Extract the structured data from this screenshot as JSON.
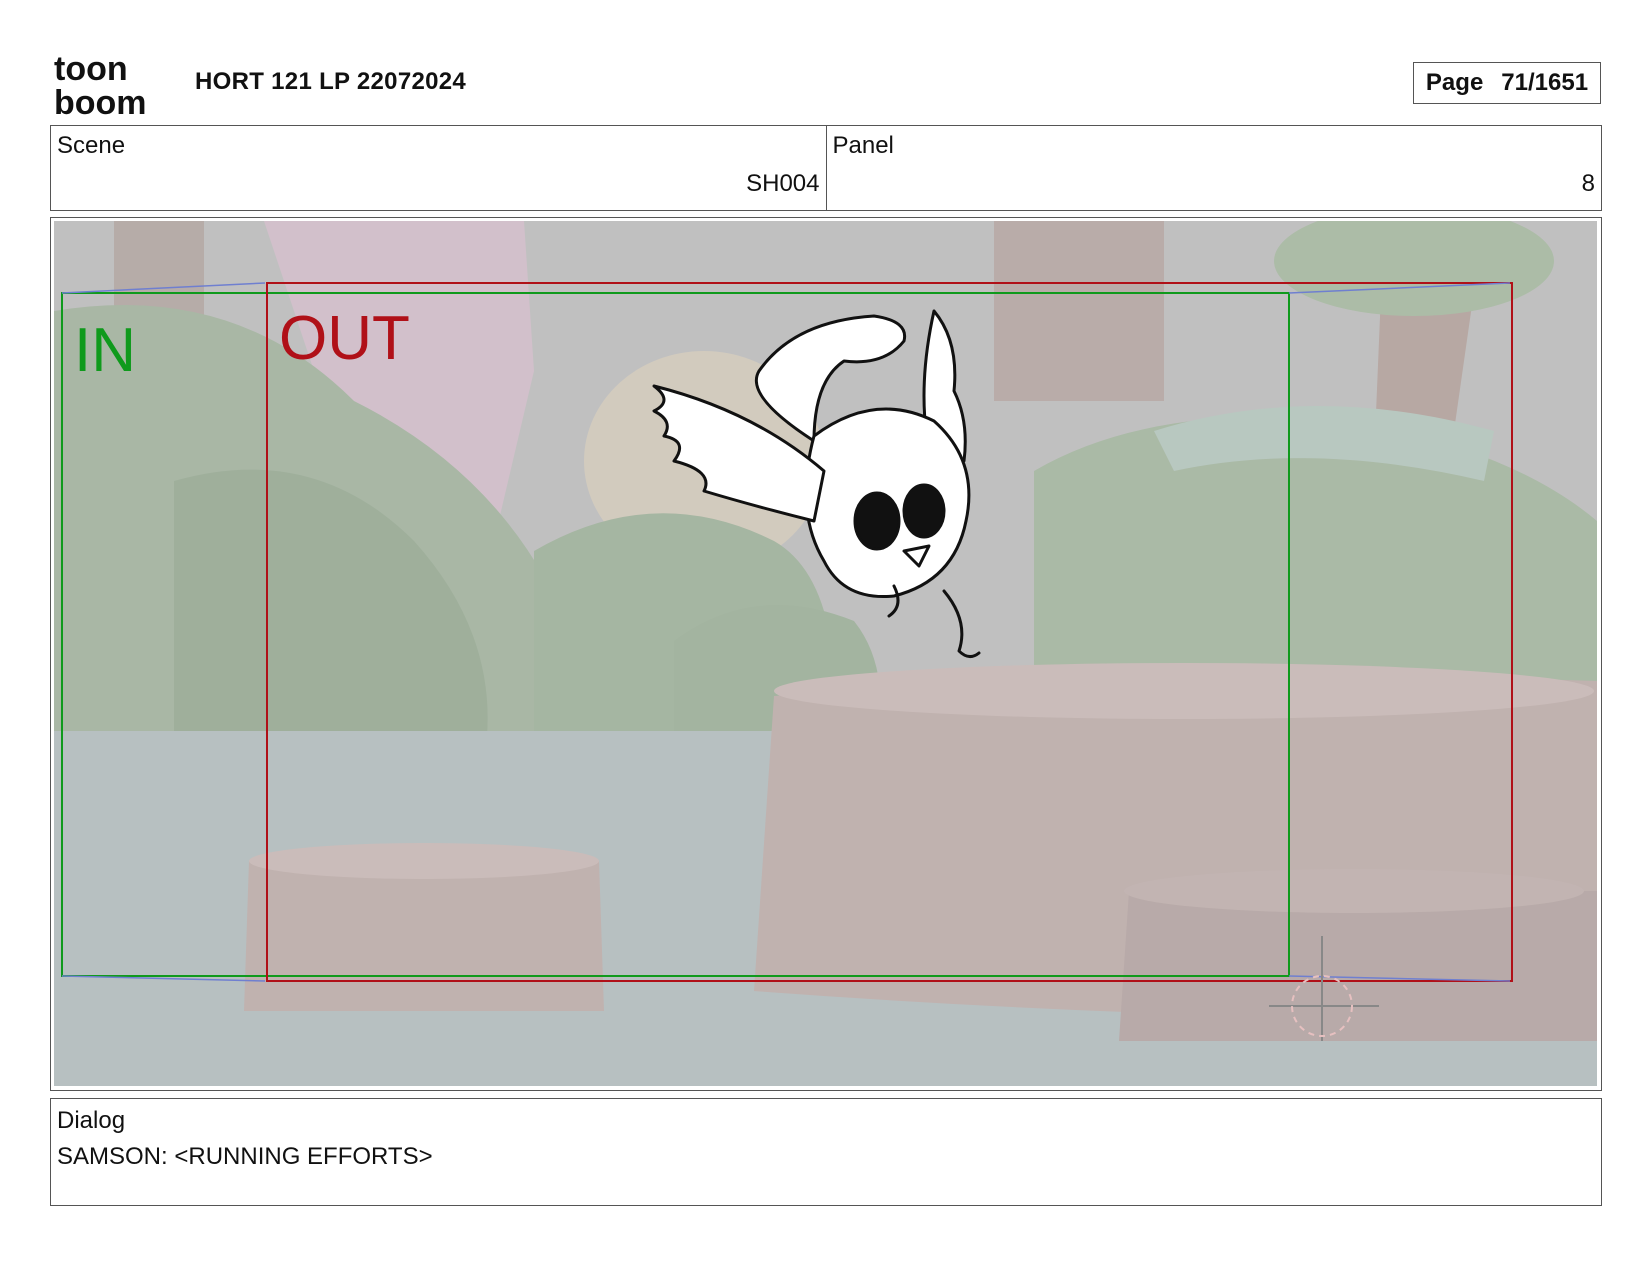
{
  "header": {
    "logo_text_top": "toon",
    "logo_text_bottom": "boom",
    "project_title": "HORT 121 LP 22072024",
    "page_label": "Page",
    "page_value": "71/1651"
  },
  "scene": {
    "label": "Scene",
    "value": "SH004"
  },
  "panel": {
    "label": "Panel",
    "value": "8"
  },
  "camera": {
    "in_label": "IN",
    "out_label": "OUT",
    "in_color": "#0f9a1c",
    "out_color": "#b01018"
  },
  "image": {
    "content_icon": "bird-character-sketch-icon"
  },
  "dialog": {
    "label": "Dialog",
    "text": "SAMSON: <RUNNING EFFORTS>"
  }
}
